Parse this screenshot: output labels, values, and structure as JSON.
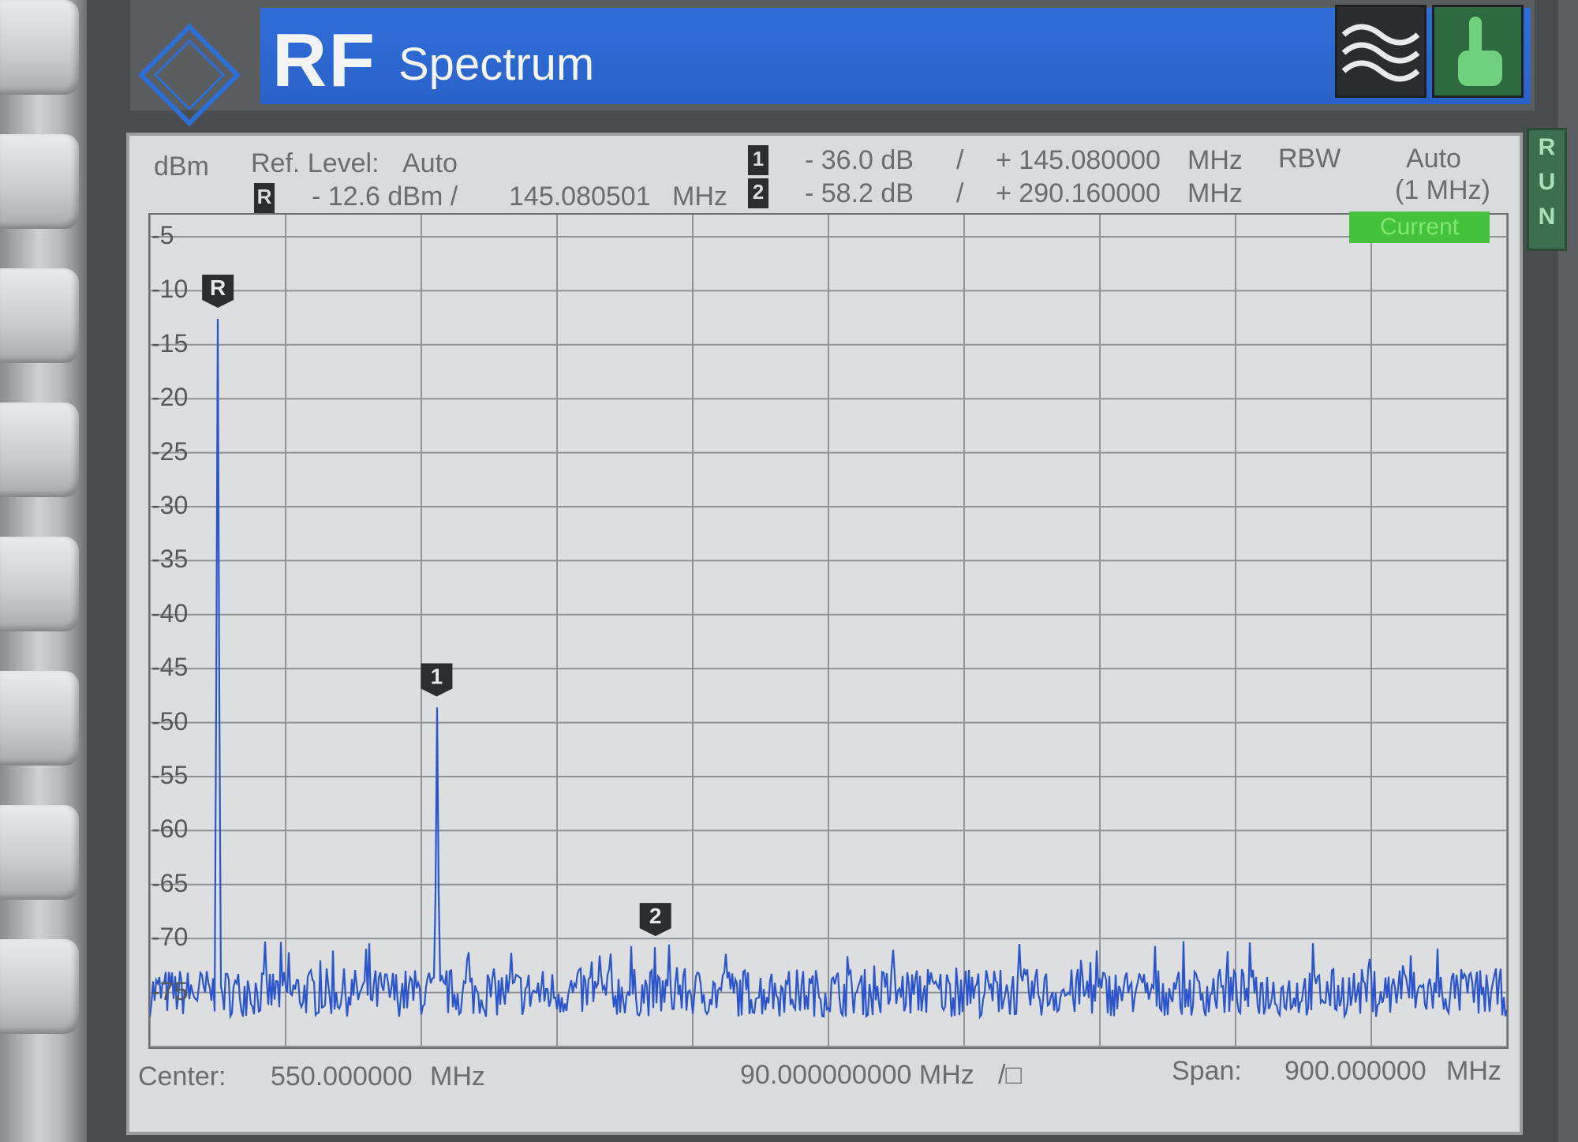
{
  "title": {
    "rf": "RF",
    "app": "Spectrum"
  },
  "header": {
    "unit": "dBm",
    "ref_level_label": "Ref. Level:",
    "ref_level_value": "Auto",
    "ref_marker_line": "- 12.6 dBm /",
    "ref_marker_freq": "145.080501",
    "ref_marker_freq_unit": "MHz",
    "m1_level": "- 36.0  dB",
    "m1_freq": "+ 145.080000",
    "m1_unit": "MHz",
    "m2_level": "- 58.2  dB",
    "m2_freq": "+ 290.160000",
    "m2_unit": "MHz",
    "slash": "/",
    "rbw_label": "RBW",
    "rbw_value": "Auto",
    "rbw_sub": "(1 MHz)",
    "current_badge": "Current",
    "marker_r": "R",
    "marker_1": "1",
    "marker_2": "2"
  },
  "run_indicator": [
    "R",
    "U",
    "N"
  ],
  "footer": {
    "center_label": "Center:",
    "center_value": "550.000000",
    "center_unit": "MHz",
    "div_value": "90.000000000 MHz",
    "div_unit": "/□",
    "span_label": "Span:",
    "span_value": "900.000000",
    "span_unit": "MHz"
  },
  "chart_data": {
    "type": "line",
    "xlabel": "",
    "ylabel": "dBm",
    "xlim": [
      100,
      1000
    ],
    "ylim": [
      -80,
      -5
    ],
    "y_ticks": [
      -5,
      -10,
      -15,
      -20,
      -25,
      -30,
      -35,
      -40,
      -45,
      -50,
      -55,
      -60,
      -65,
      -70,
      -75
    ],
    "noise_floor_dbm": -75,
    "peaks": [
      {
        "label": "R",
        "freq_mhz": 145.08,
        "level_dbm": -12.6
      },
      {
        "label": "1",
        "freq_mhz": 290.16,
        "level_dbm": -48.6
      },
      {
        "label": "2",
        "freq_mhz": 435.24,
        "level_dbm": -70.8
      },
      {
        "label": "",
        "freq_mhz": 580.3,
        "level_dbm": -72.5
      }
    ],
    "trace_color": "#2c55c9",
    "grid": true
  }
}
